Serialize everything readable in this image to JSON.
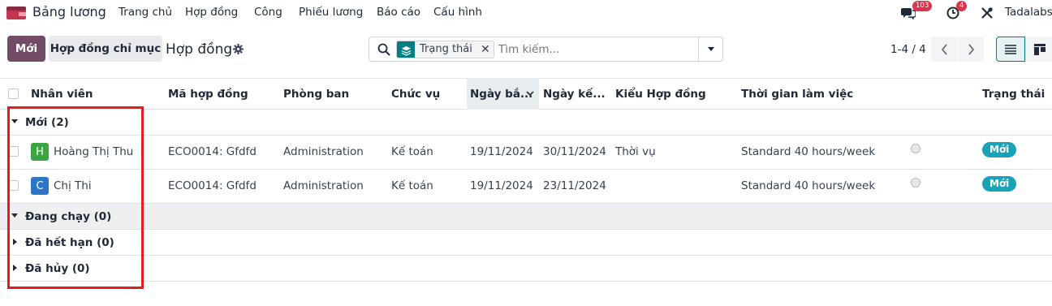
{
  "topnav": {
    "app_title": "Bảng lương",
    "menu": [
      "Trang chủ",
      "Hợp đồng",
      "Công",
      "Phiếu lương",
      "Báo cáo",
      "Cấu hình"
    ],
    "messages_count": "103",
    "activities_count": "4",
    "company": "Tadalabs"
  },
  "control": {
    "new_label": "Mới",
    "index_label": "Hợp đồng chỉ mục",
    "breadcrumb": "Hợp đồng",
    "facet_label": "Trạng thái",
    "search_placeholder": "Tìm kiếm...",
    "pager": "1-4 / 4"
  },
  "table": {
    "headers": [
      "Nhân viên",
      "Mã hợp đồng",
      "Phòng ban",
      "Chức vụ",
      "Ngày bắ...",
      "Ngày kế...",
      "Kiểu Hợp đồng",
      "Thời gian làm việc",
      "Trạng thái"
    ],
    "groups": [
      {
        "label": "Mới (2)"
      },
      {
        "label": "Đang chạy (0)"
      },
      {
        "label": "Đã hết hạn (0)"
      },
      {
        "label": "Đã hủy (0)"
      }
    ],
    "rows": [
      {
        "initial": "H",
        "avatar_color": "#3aa541",
        "employee": "Hoàng Thị Thu",
        "code": "ECO0014: Gfdfd",
        "department": "Administration",
        "position": "Kế toán",
        "start": "19/11/2024",
        "end": "30/11/2024",
        "type": "Thời vụ",
        "schedule": "Standard 40 hours/week",
        "status": "Mới"
      },
      {
        "initial": "C",
        "avatar_color": "#2d76c7",
        "employee": "Chị Thi",
        "code": "ECO0014: Gfdfd",
        "department": "Administration",
        "position": "Kế toán",
        "start": "19/11/2024",
        "end": "23/11/2024",
        "type": "",
        "schedule": "Standard 40 hours/week",
        "status": "Mới"
      }
    ]
  },
  "colors": {
    "primary": "#714b67",
    "accent": "#017e84",
    "status_new": "#1aa2b8",
    "highlight": "#e02020"
  }
}
